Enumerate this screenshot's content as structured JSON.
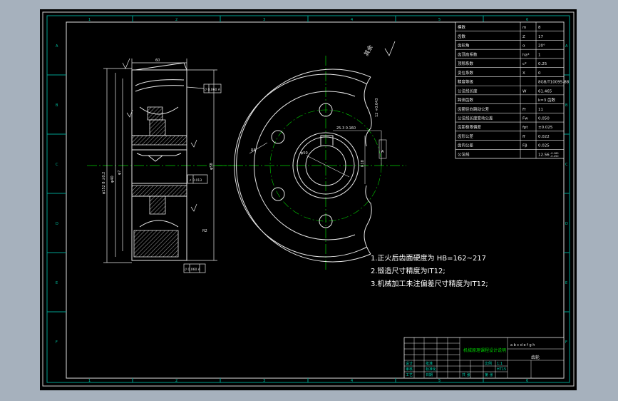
{
  "border": {
    "top_zones": [
      "1",
      "2",
      "3",
      "4",
      "5",
      "6"
    ],
    "bottom_zones": [
      "1",
      "2",
      "3",
      "4",
      "5",
      "6"
    ],
    "left_zones": [
      "A",
      "B",
      "C",
      "D",
      "E",
      "F"
    ],
    "right_zones": [
      "A",
      "B",
      "C",
      "D",
      "E",
      "F"
    ]
  },
  "params_table": {
    "rows": [
      {
        "label": "模数",
        "sym": "m",
        "val": "8"
      },
      {
        "label": "齿数",
        "sym": "Z",
        "val": "17"
      },
      {
        "label": "齿形角",
        "sym": "α",
        "val": "20°"
      },
      {
        "label": "齿顶高系数",
        "sym": "ha*",
        "val": "1"
      },
      {
        "label": "顶隙系数",
        "sym": "c*",
        "val": "0.25"
      },
      {
        "label": "变位系数",
        "sym": "X",
        "val": "0"
      },
      {
        "label": "精度等级",
        "sym": "",
        "val": "8GB/T10095-88"
      },
      {
        "label": "公法线长度",
        "sym": "W",
        "val": "61.465"
      },
      {
        "label": "跨测齿数",
        "sym": "",
        "val": "k=3 齿数"
      },
      {
        "label": "齿圈径向跳动公差",
        "sym": "Fr",
        "val": "11"
      },
      {
        "label": "公法线长度变动公差",
        "sym": "Fw",
        "val": "0.050"
      },
      {
        "label": "齿距极限偏差",
        "sym": "fpt",
        "val": "±0.025"
      },
      {
        "label": "齿形公差",
        "sym": "ff",
        "val": "0.022"
      },
      {
        "label": "齿向公差",
        "sym": "Fβ",
        "val": "0.025"
      },
      {
        "label": "公法线",
        "sym": "",
        "val": "12.56"
      }
    ],
    "last_tol_upper": "-0.160",
    "last_tol_lower": "-0.250"
  },
  "notes": [
    "1.正火后齿面硬度为 HB=162~217",
    "2.锻造尺寸精度为IT12;",
    "3.机械加工未注偏差尺寸精度为IT12;"
  ],
  "roughness_label": "其余",
  "annotations": {
    "gd_symbol_top": "// 0.060 A",
    "gd_symbol_mid": "↗ 0.013",
    "gd_symbol_bot": "// 0.060 A",
    "dim_top": "60",
    "dim_keyway": "25.3 0.160",
    "dim_radius": "R5",
    "dim_bore": "φ50",
    "dim_left_a": "φ152 8 ±0.2",
    "dim_left_b": "φ40",
    "dim_left_c": "φ7",
    "dim_right_r": "R2",
    "dim_bore_side": "φ58",
    "datum_label": "A",
    "keyway_tol": "12 +0.043",
    "keyway_width": "R18"
  },
  "title_block": {
    "drawing_name": "齿轮",
    "company": "机械原理课程设计说明",
    "scale_header": "a b c d e f g h",
    "cells": [
      "设计",
      "审核",
      "工艺",
      "批准",
      "标准化",
      "日期",
      "比例",
      "1:1",
      "共  张",
      "第  张",
      "HT15"
    ]
  }
}
